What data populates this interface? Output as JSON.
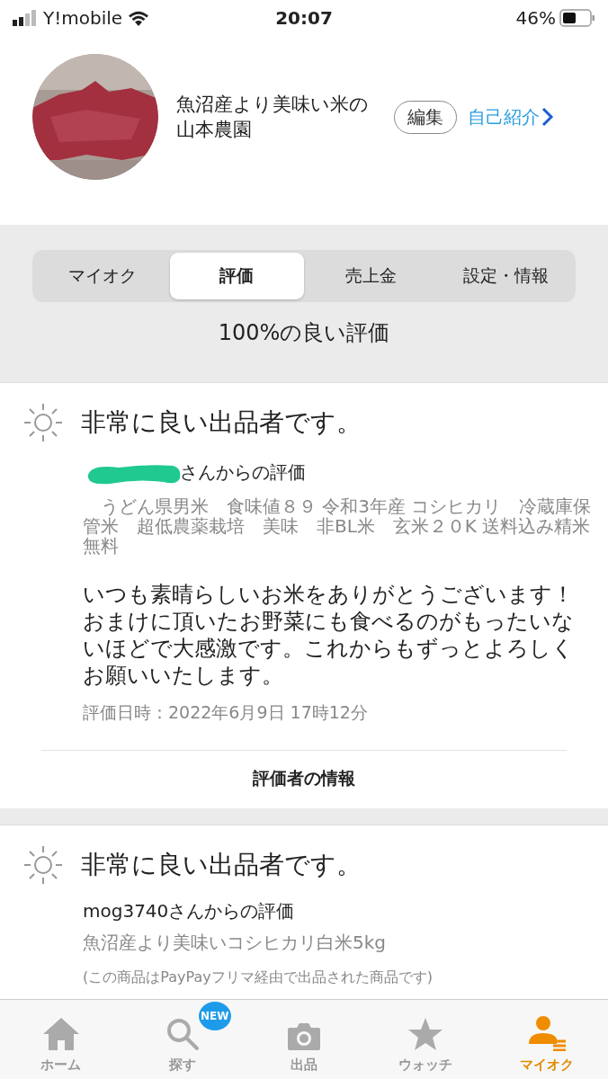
{
  "status_bar": {
    "carrier": "Y!mobile",
    "time": "20:07",
    "battery": "46%"
  },
  "profile": {
    "name": "魚沼産より美味い米の山本農園",
    "edit_button": "編集",
    "intro_link": "自己紹介"
  },
  "segments": [
    {
      "label": "マイオク",
      "selected": false
    },
    {
      "label": "評価",
      "selected": true
    },
    {
      "label": "売上金",
      "selected": false
    },
    {
      "label": "設定・情報",
      "selected": false
    }
  ],
  "rating_summary": "100%の良い評価",
  "reviews": [
    {
      "rating": "非常に良い出品者です。",
      "reviewer": "さんからの評価",
      "redacted": true,
      "item": "　うどん県男米　食味値８９ 令和3年産 コシヒカリ　冷蔵庫保管米　超低農薬栽培　美味　非BL米　玄米２０K 送料込み精米無料",
      "comment": "いつも素晴らしいお米をありがとうございます！おまけに頂いたお野菜にも食べるのがもったいないほどで大感激です。これからもずっとよろしくお願いいたします。",
      "date": "評価日時：2022年6月9日 17時12分",
      "info_button": "評価者の情報"
    },
    {
      "rating": "非常に良い出品者です。",
      "reviewer": "mog3740さんからの評価",
      "redacted": false,
      "item": "魚沼産より美味いコシヒカリ白米5kg",
      "note": "(この商品はPayPayフリマ経由で出品された商品です)"
    }
  ],
  "tab_bar": [
    {
      "kind": "home",
      "label": "ホーム",
      "selected": false
    },
    {
      "kind": "search",
      "label": "探す",
      "selected": false,
      "badge": "NEW"
    },
    {
      "kind": "camera",
      "label": "出品",
      "selected": false
    },
    {
      "kind": "star",
      "label": "ウォッチ",
      "selected": false
    },
    {
      "kind": "person",
      "label": "マイオク",
      "selected": true
    }
  ]
}
